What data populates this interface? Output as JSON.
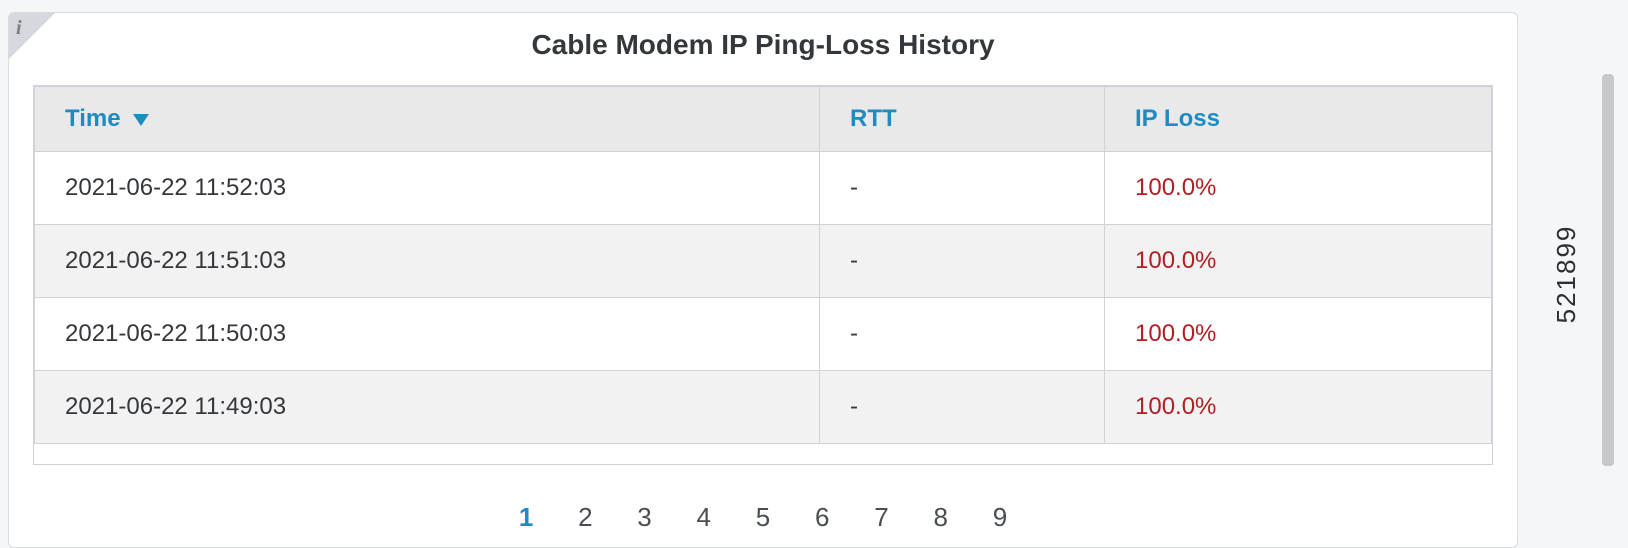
{
  "panel": {
    "title": "Cable Modem IP Ping-Loss History",
    "info_icon_label": "i"
  },
  "table": {
    "columns": {
      "time": "Time",
      "rtt": "RTT",
      "ip_loss": "IP Loss"
    },
    "sort": {
      "column": "time",
      "direction": "desc"
    },
    "rows": [
      {
        "time": "2021-06-22 11:52:03",
        "rtt": "-",
        "ip_loss": "100.0%"
      },
      {
        "time": "2021-06-22 11:51:03",
        "rtt": "-",
        "ip_loss": "100.0%"
      },
      {
        "time": "2021-06-22 11:50:03",
        "rtt": "-",
        "ip_loss": "100.0%"
      },
      {
        "time": "2021-06-22 11:49:03",
        "rtt": "-",
        "ip_loss": "100.0%"
      }
    ]
  },
  "pagination": {
    "pages": [
      "1",
      "2",
      "3",
      "4",
      "5",
      "6",
      "7",
      "8",
      "9"
    ],
    "current": "1"
  },
  "annotation": {
    "side_number": "521899"
  },
  "colors": {
    "header_link": "#1e8bc3",
    "loss_red": "#b01f24",
    "row_alt": "#f2f2f2",
    "border": "#cfd3d7"
  }
}
